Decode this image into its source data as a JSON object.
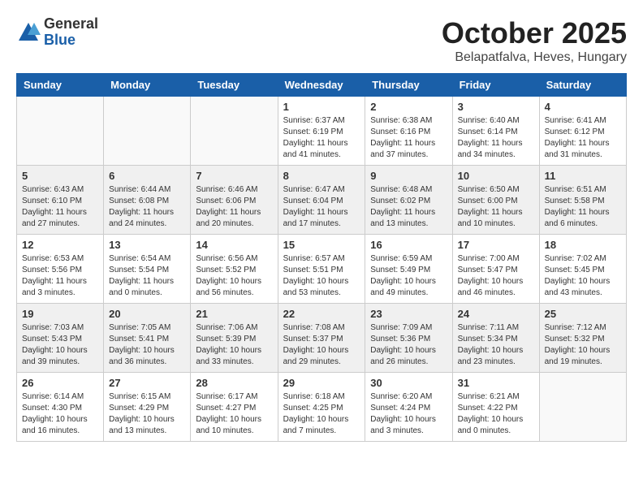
{
  "header": {
    "logo_general": "General",
    "logo_blue": "Blue",
    "title": "October 2025",
    "location": "Belapatfalva, Heves, Hungary"
  },
  "days_of_week": [
    "Sunday",
    "Monday",
    "Tuesday",
    "Wednesday",
    "Thursday",
    "Friday",
    "Saturday"
  ],
  "weeks": [
    {
      "shade": false,
      "days": [
        {
          "num": "",
          "info": ""
        },
        {
          "num": "",
          "info": ""
        },
        {
          "num": "",
          "info": ""
        },
        {
          "num": "1",
          "info": "Sunrise: 6:37 AM\nSunset: 6:19 PM\nDaylight: 11 hours\nand 41 minutes."
        },
        {
          "num": "2",
          "info": "Sunrise: 6:38 AM\nSunset: 6:16 PM\nDaylight: 11 hours\nand 37 minutes."
        },
        {
          "num": "3",
          "info": "Sunrise: 6:40 AM\nSunset: 6:14 PM\nDaylight: 11 hours\nand 34 minutes."
        },
        {
          "num": "4",
          "info": "Sunrise: 6:41 AM\nSunset: 6:12 PM\nDaylight: 11 hours\nand 31 minutes."
        }
      ]
    },
    {
      "shade": true,
      "days": [
        {
          "num": "5",
          "info": "Sunrise: 6:43 AM\nSunset: 6:10 PM\nDaylight: 11 hours\nand 27 minutes."
        },
        {
          "num": "6",
          "info": "Sunrise: 6:44 AM\nSunset: 6:08 PM\nDaylight: 11 hours\nand 24 minutes."
        },
        {
          "num": "7",
          "info": "Sunrise: 6:46 AM\nSunset: 6:06 PM\nDaylight: 11 hours\nand 20 minutes."
        },
        {
          "num": "8",
          "info": "Sunrise: 6:47 AM\nSunset: 6:04 PM\nDaylight: 11 hours\nand 17 minutes."
        },
        {
          "num": "9",
          "info": "Sunrise: 6:48 AM\nSunset: 6:02 PM\nDaylight: 11 hours\nand 13 minutes."
        },
        {
          "num": "10",
          "info": "Sunrise: 6:50 AM\nSunset: 6:00 PM\nDaylight: 11 hours\nand 10 minutes."
        },
        {
          "num": "11",
          "info": "Sunrise: 6:51 AM\nSunset: 5:58 PM\nDaylight: 11 hours\nand 6 minutes."
        }
      ]
    },
    {
      "shade": false,
      "days": [
        {
          "num": "12",
          "info": "Sunrise: 6:53 AM\nSunset: 5:56 PM\nDaylight: 11 hours\nand 3 minutes."
        },
        {
          "num": "13",
          "info": "Sunrise: 6:54 AM\nSunset: 5:54 PM\nDaylight: 11 hours\nand 0 minutes."
        },
        {
          "num": "14",
          "info": "Sunrise: 6:56 AM\nSunset: 5:52 PM\nDaylight: 10 hours\nand 56 minutes."
        },
        {
          "num": "15",
          "info": "Sunrise: 6:57 AM\nSunset: 5:51 PM\nDaylight: 10 hours\nand 53 minutes."
        },
        {
          "num": "16",
          "info": "Sunrise: 6:59 AM\nSunset: 5:49 PM\nDaylight: 10 hours\nand 49 minutes."
        },
        {
          "num": "17",
          "info": "Sunrise: 7:00 AM\nSunset: 5:47 PM\nDaylight: 10 hours\nand 46 minutes."
        },
        {
          "num": "18",
          "info": "Sunrise: 7:02 AM\nSunset: 5:45 PM\nDaylight: 10 hours\nand 43 minutes."
        }
      ]
    },
    {
      "shade": true,
      "days": [
        {
          "num": "19",
          "info": "Sunrise: 7:03 AM\nSunset: 5:43 PM\nDaylight: 10 hours\nand 39 minutes."
        },
        {
          "num": "20",
          "info": "Sunrise: 7:05 AM\nSunset: 5:41 PM\nDaylight: 10 hours\nand 36 minutes."
        },
        {
          "num": "21",
          "info": "Sunrise: 7:06 AM\nSunset: 5:39 PM\nDaylight: 10 hours\nand 33 minutes."
        },
        {
          "num": "22",
          "info": "Sunrise: 7:08 AM\nSunset: 5:37 PM\nDaylight: 10 hours\nand 29 minutes."
        },
        {
          "num": "23",
          "info": "Sunrise: 7:09 AM\nSunset: 5:36 PM\nDaylight: 10 hours\nand 26 minutes."
        },
        {
          "num": "24",
          "info": "Sunrise: 7:11 AM\nSunset: 5:34 PM\nDaylight: 10 hours\nand 23 minutes."
        },
        {
          "num": "25",
          "info": "Sunrise: 7:12 AM\nSunset: 5:32 PM\nDaylight: 10 hours\nand 19 minutes."
        }
      ]
    },
    {
      "shade": false,
      "days": [
        {
          "num": "26",
          "info": "Sunrise: 6:14 AM\nSunset: 4:30 PM\nDaylight: 10 hours\nand 16 minutes."
        },
        {
          "num": "27",
          "info": "Sunrise: 6:15 AM\nSunset: 4:29 PM\nDaylight: 10 hours\nand 13 minutes."
        },
        {
          "num": "28",
          "info": "Sunrise: 6:17 AM\nSunset: 4:27 PM\nDaylight: 10 hours\nand 10 minutes."
        },
        {
          "num": "29",
          "info": "Sunrise: 6:18 AM\nSunset: 4:25 PM\nDaylight: 10 hours\nand 7 minutes."
        },
        {
          "num": "30",
          "info": "Sunrise: 6:20 AM\nSunset: 4:24 PM\nDaylight: 10 hours\nand 3 minutes."
        },
        {
          "num": "31",
          "info": "Sunrise: 6:21 AM\nSunset: 4:22 PM\nDaylight: 10 hours\nand 0 minutes."
        },
        {
          "num": "",
          "info": ""
        }
      ]
    }
  ]
}
